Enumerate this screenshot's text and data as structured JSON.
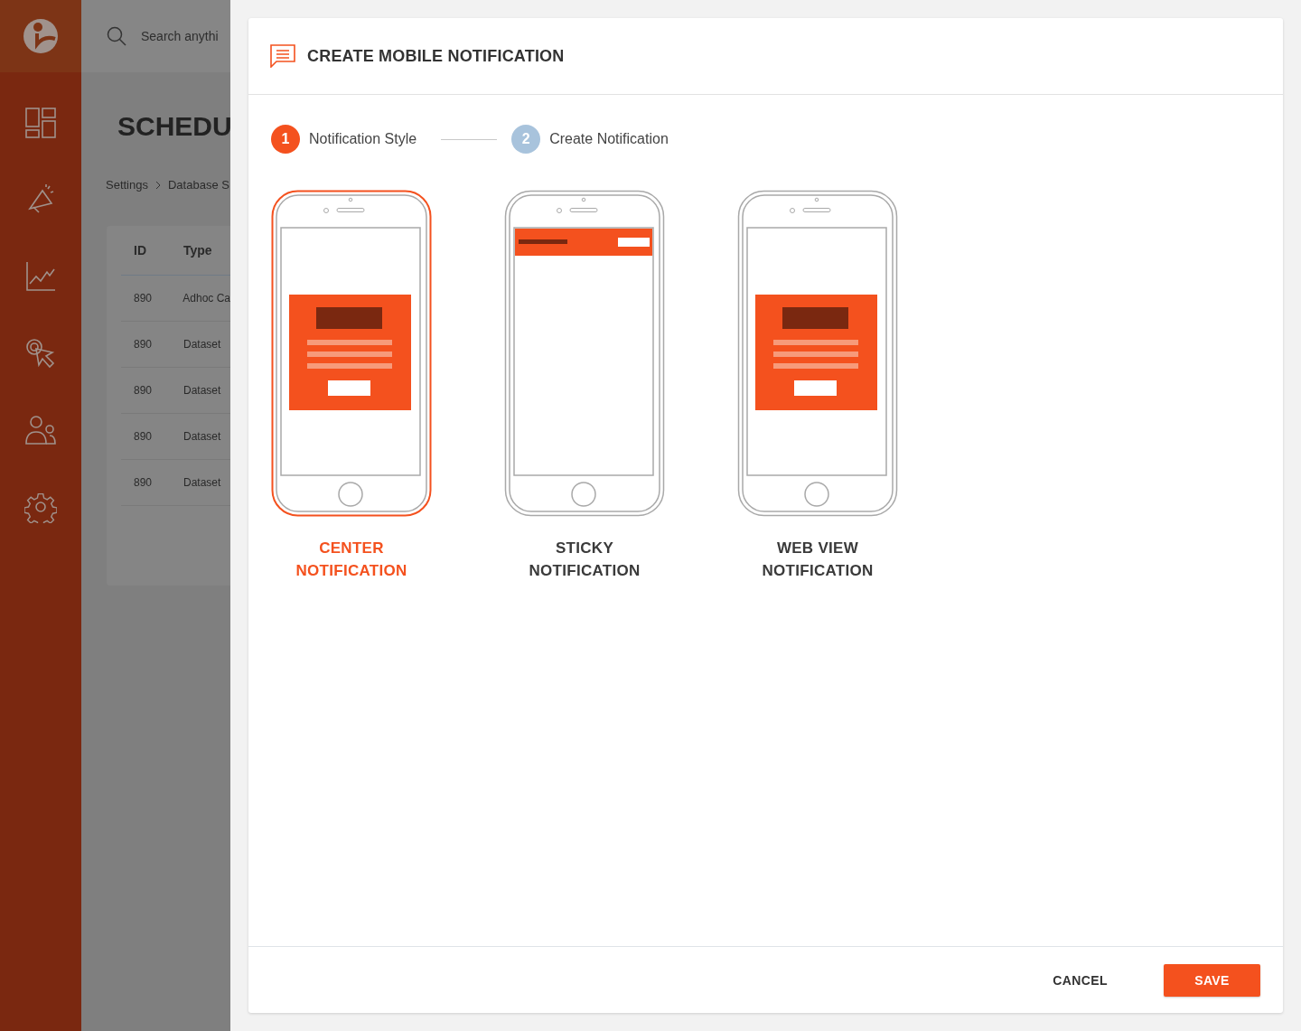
{
  "search": {
    "placeholder": "Search anythi"
  },
  "page": {
    "title": "SCHEDU",
    "breadcrumb": [
      "Settings",
      "Database S"
    ]
  },
  "table": {
    "columns": [
      "ID",
      "Type"
    ],
    "rows": [
      [
        "890",
        "Adhoc Ca"
      ],
      [
        "890",
        "Dataset"
      ],
      [
        "890",
        "Dataset"
      ],
      [
        "890",
        "Dataset"
      ],
      [
        "890",
        "Dataset"
      ]
    ]
  },
  "dialog": {
    "title": "CREATE MOBILE NOTIFICATION",
    "steps": [
      {
        "number": "1",
        "label": "Notification Style",
        "selected": true
      },
      {
        "number": "2",
        "label": "Create Notification",
        "selected": false
      }
    ],
    "styles": [
      {
        "kind": "center",
        "label": "CENTER NOTIFICATION",
        "selected": true
      },
      {
        "kind": "sticky",
        "label": "STICKY NOTIFICATION",
        "selected": false
      },
      {
        "kind": "webview",
        "label": "WEB VIEW NOTIFICATION",
        "selected": false
      }
    ],
    "buttons": [
      {
        "kind": "text",
        "label": "CANCEL"
      },
      {
        "kind": "primary",
        "label": "SAVE"
      }
    ]
  }
}
